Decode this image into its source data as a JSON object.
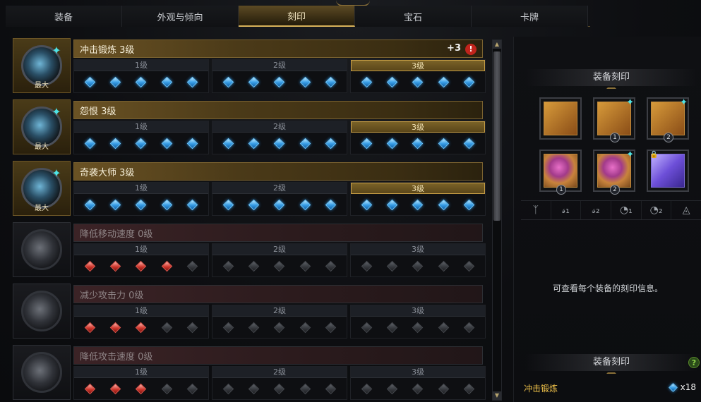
{
  "tabs": [
    "装备",
    "外观与倾向",
    "刻印",
    "宝石",
    "卡牌"
  ],
  "active_tab": 2,
  "engravings": [
    {
      "name": "冲击锻炼 3级",
      "badge": "最大",
      "bonus": "+3",
      "warn": "!",
      "state": "active",
      "levels": [
        "1级",
        "2级",
        "3级"
      ],
      "current_level": 3,
      "gems": [
        "b",
        "b",
        "b",
        "b",
        "b",
        "b",
        "b",
        "b",
        "b",
        "b",
        "b",
        "b",
        "b",
        "b",
        "b"
      ]
    },
    {
      "name": "怨恨 3级",
      "badge": "最大",
      "state": "active",
      "levels": [
        "1级",
        "2级",
        "3级"
      ],
      "current_level": 3,
      "gems": [
        "b",
        "b",
        "b",
        "b",
        "b",
        "b",
        "b",
        "b",
        "b",
        "b",
        "b",
        "b",
        "b",
        "b",
        "b"
      ]
    },
    {
      "name": "奇袭大师 3级",
      "badge": "最大",
      "state": "active",
      "levels": [
        "1级",
        "2级",
        "3级"
      ],
      "current_level": 3,
      "gems": [
        "b",
        "b",
        "b",
        "b",
        "b",
        "b",
        "b",
        "b",
        "b",
        "b",
        "b",
        "b",
        "b",
        "b",
        "b"
      ]
    },
    {
      "name": "降低移动速度 0级",
      "state": "inactive",
      "levels": [
        "1级",
        "2级",
        "3级"
      ],
      "current_level": 0,
      "gems": [
        "r",
        "r",
        "r",
        "r",
        "g",
        "g",
        "g",
        "g",
        "g",
        "g",
        "g",
        "g",
        "g",
        "g",
        "g"
      ]
    },
    {
      "name": "减少攻击力 0级",
      "state": "inactive",
      "levels": [
        "1级",
        "2级",
        "3级"
      ],
      "current_level": 0,
      "gems": [
        "r",
        "r",
        "r",
        "g",
        "g",
        "g",
        "g",
        "g",
        "g",
        "g",
        "g",
        "g",
        "g",
        "g",
        "g"
      ]
    },
    {
      "name": "降低攻击速度 0级",
      "state": "inactive",
      "levels": [
        "1级",
        "2级",
        "3级"
      ],
      "current_level": 0,
      "gems": [
        "r",
        "r",
        "r",
        "g",
        "g",
        "g",
        "g",
        "g",
        "g",
        "g",
        "g",
        "g",
        "g",
        "g",
        "g"
      ]
    }
  ],
  "side": {
    "title_top": "装备刻印",
    "equipment": [
      {
        "name": "necklace",
        "num": "",
        "spark": false
      },
      {
        "name": "earring",
        "num": "1",
        "spark": true
      },
      {
        "name": "earring",
        "num": "2",
        "spark": true
      },
      {
        "name": "ring",
        "num": "1",
        "spark": false
      },
      {
        "name": "ring",
        "num": "2",
        "spark": true
      },
      {
        "name": "stone",
        "num": "",
        "spark": false,
        "lock": true
      }
    ],
    "slot_icons": [
      "necklace-icon",
      "earring-1-icon",
      "earring-2-icon",
      "ring-1-icon",
      "ring-2-icon",
      "stone-icon"
    ],
    "slot_glyphs": [
      "ᛉ",
      "𝓈₁",
      "𝓈₂",
      "◔₁",
      "◔₂",
      "◬"
    ],
    "hint": "可查看每个装备的刻印信息。",
    "title_bottom": "装备刻印",
    "help": "?",
    "summary_name": "冲击锻炼",
    "summary_count": "x18"
  }
}
